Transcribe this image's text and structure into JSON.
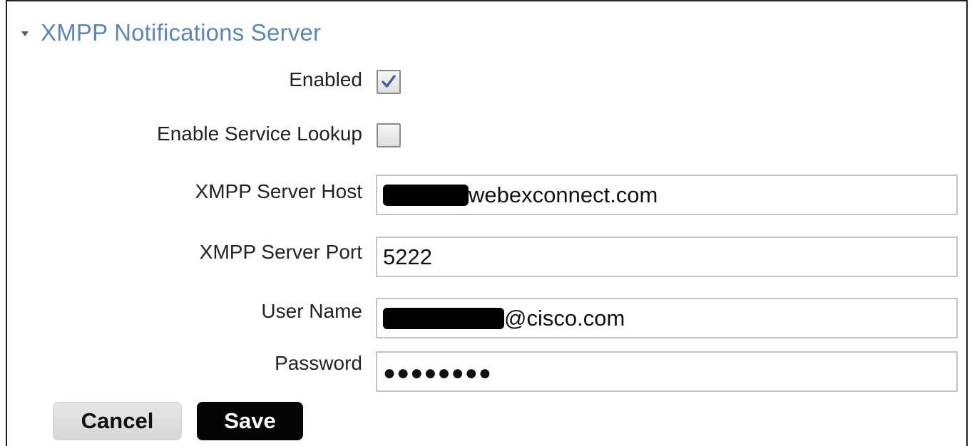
{
  "section": {
    "title": "XMPP Notifications Server",
    "collapse_icon": "triangle-down-icon"
  },
  "enabled": {
    "label": "Enabled",
    "checked": true
  },
  "service_lookup": {
    "label": "Enable Service Lookup",
    "checked": false
  },
  "server_host": {
    "label": "XMPP Server Host",
    "value_visible": "webexconnect.com"
  },
  "server_port": {
    "label": "XMPP Server Port",
    "value": "5222"
  },
  "user_name": {
    "label": "User Name",
    "value_visible": "@cisco.com"
  },
  "password": {
    "label": "Password",
    "value_masked": "●●●●●●●●"
  },
  "buttons": {
    "cancel": "Cancel",
    "save": "Save"
  },
  "colors": {
    "section_title": "#5a86b8",
    "save_bg": "#050505",
    "cancel_bg": "#e0e0e0",
    "checkmark": "#3d5fa8"
  }
}
